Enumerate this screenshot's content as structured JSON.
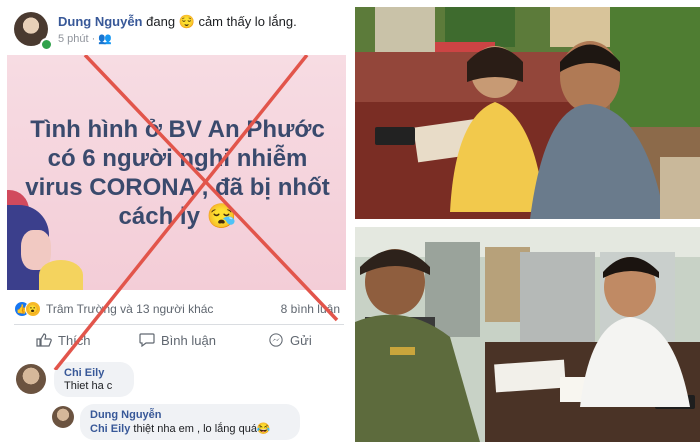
{
  "post": {
    "author": "Dung Nguyễn",
    "feeling": "đang 😌 cảm thấy lo lắng.",
    "time": "5 phút · 👥",
    "text": "Tình hình ở BV An Phước có 6 người nghi nhiễm virus CORONA , đã bị nhốt cách ly 😪"
  },
  "reactions": {
    "summary": "Trâm Trường và 13 người khác",
    "comments": "8 bình luận"
  },
  "actions": {
    "like": "Thích",
    "comment": "Bình luận",
    "share": "Gửi"
  },
  "comments": [
    {
      "name": "Chi Eily",
      "text": "Thiet ha c"
    },
    {
      "name": "Dung Nguyễn",
      "mention": "Chi Eily",
      "text": "thiệt nha em , lo lắng quá😂"
    }
  ],
  "colors": {
    "cross": "#e2554b",
    "card": "#f5d3dc",
    "post_text": "#3a4a6d",
    "link": "#385898"
  }
}
